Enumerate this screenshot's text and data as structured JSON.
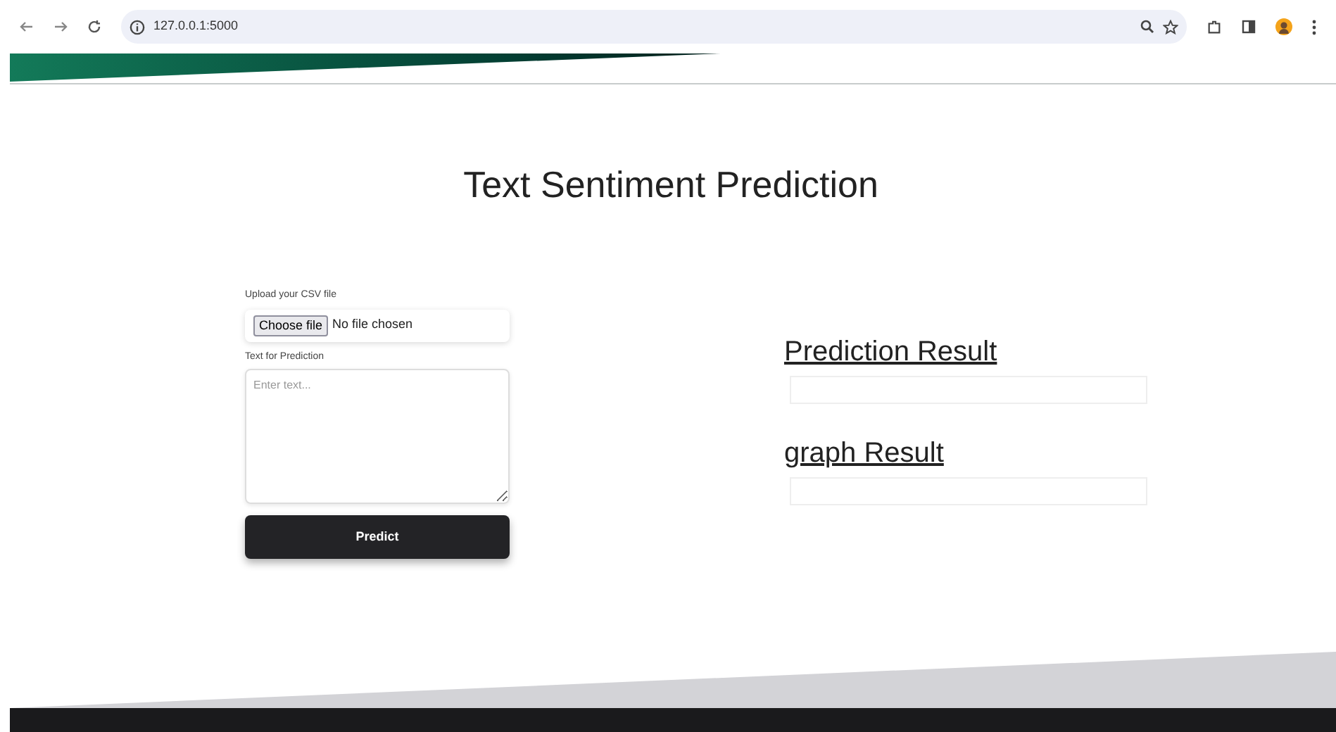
{
  "browser": {
    "url": "127.0.0.1:5000"
  },
  "title": "Text Sentiment Prediction",
  "form": {
    "upload_label": "Upload your CSV file",
    "file_button": "Choose file",
    "file_status": "No file chosen",
    "text_label": "Text for Prediction",
    "text_placeholder": "Enter text...",
    "submit": "Predict"
  },
  "results": [
    {
      "heading": "Prediction Result"
    },
    {
      "heading": "graph Result"
    }
  ]
}
